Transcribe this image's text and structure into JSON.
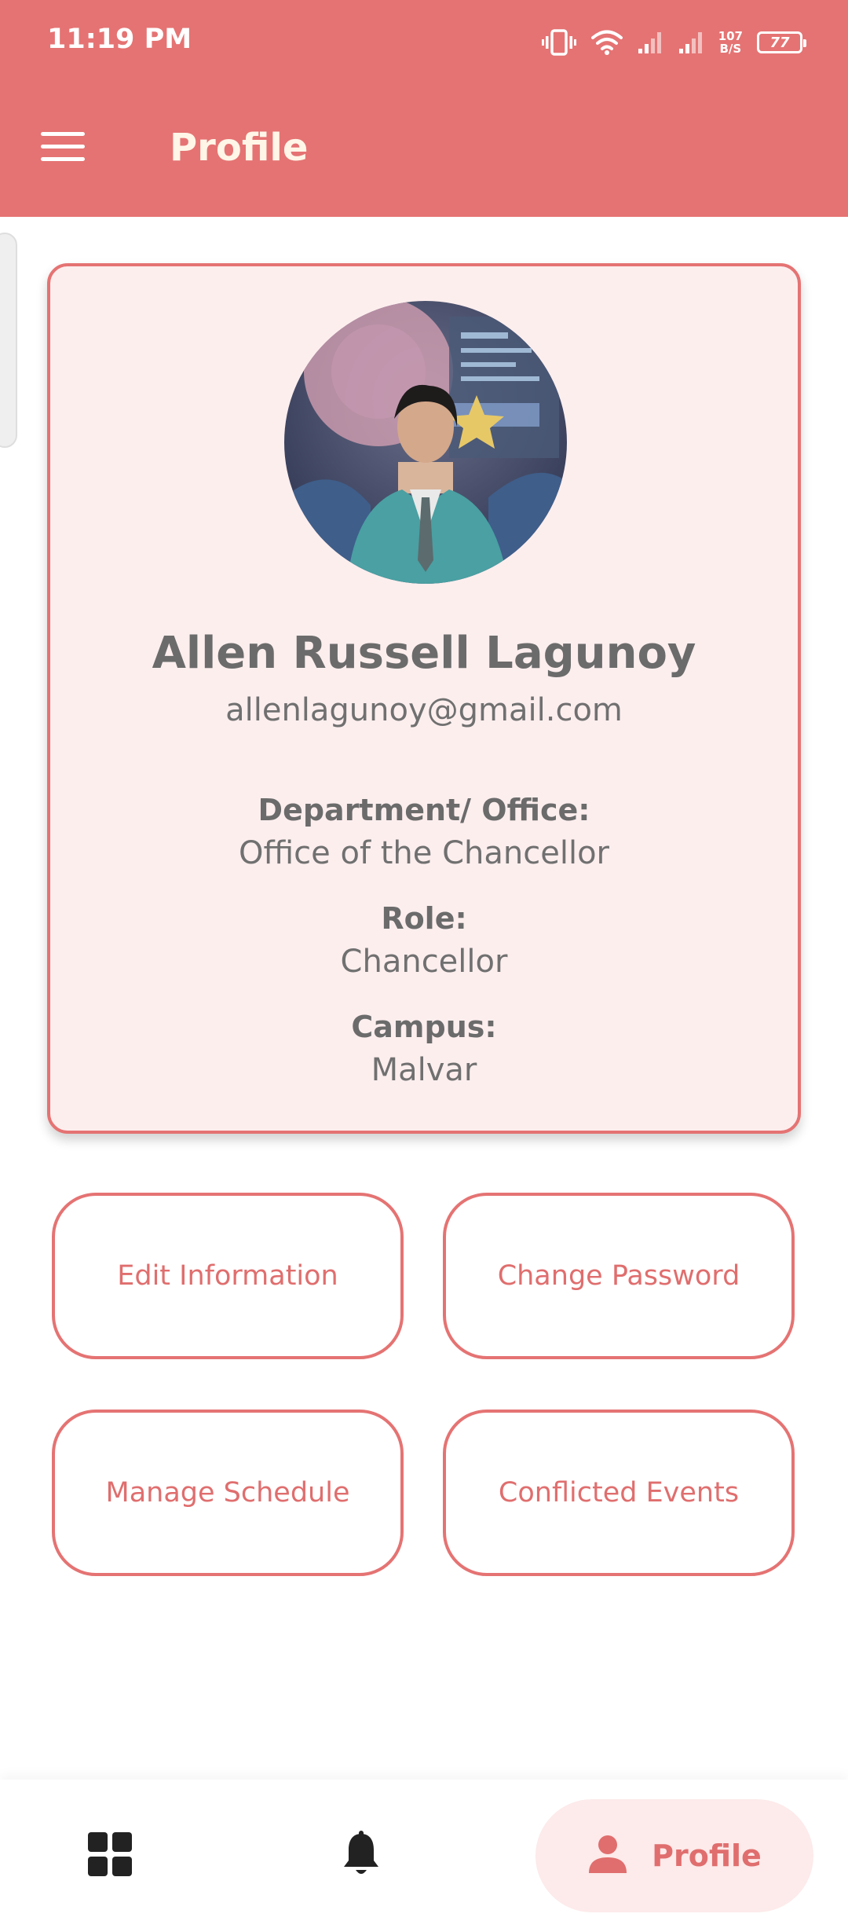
{
  "status_bar": {
    "time": "11:19 PM",
    "net_speed_value": "107",
    "net_speed_unit": "B/S",
    "battery": "77",
    "icons": [
      "vibrate-icon",
      "wifi-icon",
      "signal-icon",
      "signal-icon",
      "battery-icon"
    ]
  },
  "app_bar": {
    "title": "Profile",
    "menu_icon": "menu-icon"
  },
  "profile": {
    "name": "Allen Russell Lagunoy",
    "email": "allenlagunoy@gmail.com",
    "department_label": "Department/ Office:",
    "department_value": "Office of the Chancellor",
    "role_label": "Role:",
    "role_value": "Chancellor",
    "campus_label": "Campus:",
    "campus_value": "Malvar"
  },
  "actions": {
    "edit_information": "Edit Information",
    "change_password": "Change Password",
    "manage_schedule": "Manage Schedule",
    "conflicted_events": "Conflicted Events"
  },
  "bottom_nav": {
    "items": [
      {
        "icon": "dashboard-grid-icon"
      },
      {
        "icon": "bell-icon"
      },
      {
        "icon": "person-icon",
        "label": "Profile",
        "active": true
      }
    ]
  },
  "colors": {
    "primary": "#e57373",
    "card_bg": "#fdeeee",
    "title_text": "#fff6e8",
    "body_text": "#6b6b6b"
  }
}
